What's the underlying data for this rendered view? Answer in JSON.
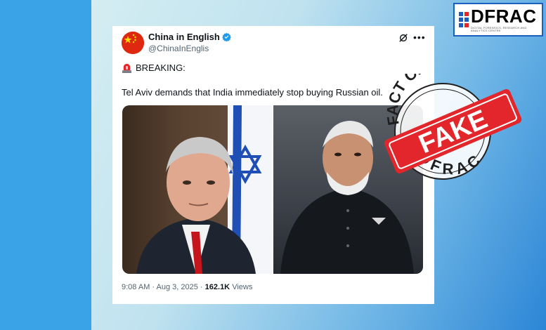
{
  "logo": {
    "text": "DFRAC",
    "tagline": "DIGITAL FORENSICS, RESEARCH AND ANALYTICS CENTRE"
  },
  "tweet": {
    "display_name": "China in English",
    "handle": "@ChinaInEnglis",
    "breaking_label": "BREAKING:",
    "text": "Tel Aviv demands that India immediately stop buying Russian oil.",
    "time": "9:08 AM",
    "separator": " · ",
    "date": "Aug 3, 2025",
    "views_count": "162.1K",
    "views_label": "Views"
  },
  "stamp": {
    "top_text": "FACT CHECK",
    "label": "FAKE",
    "bottom_text": "DFRAC"
  },
  "icons": [
    "siren-icon",
    "verified-badge-icon",
    "grok-icon",
    "more-icon",
    "china-flag-icon"
  ],
  "colors": {
    "stamp_red": "#e2262b",
    "brand_blue": "#1d5fbf",
    "verified_blue": "#1d9bf0"
  }
}
